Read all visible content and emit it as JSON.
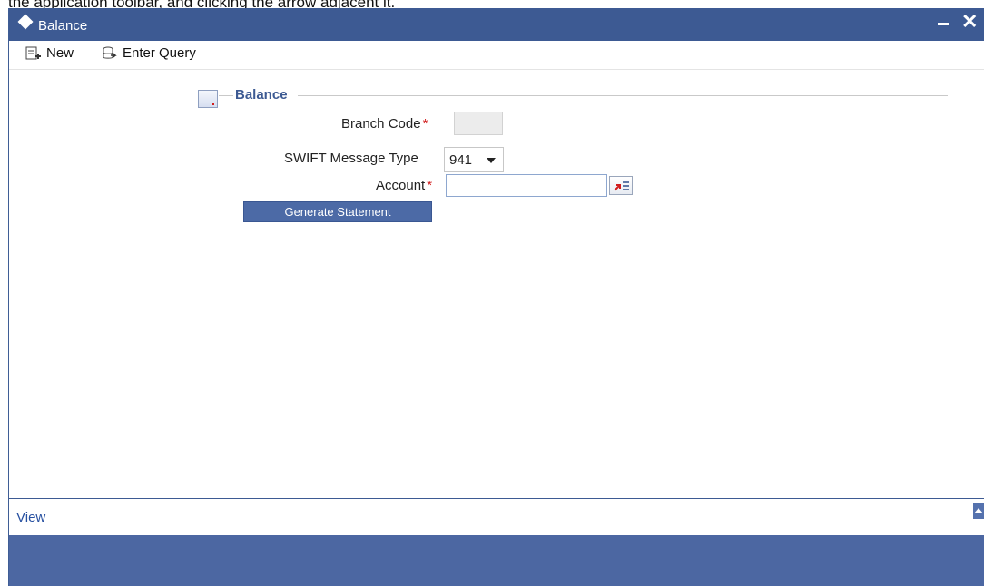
{
  "document_fragment": "the application toolbar, and clicking the arrow adjacent it.",
  "window": {
    "title": "Balance",
    "minimize_label": "",
    "close_label": "✕"
  },
  "toolbar": {
    "new_label": "New",
    "enter_query_label": "Enter Query"
  },
  "section": {
    "title": "Balance"
  },
  "form": {
    "branch_code_label": "Branch Code",
    "branch_code_value": "",
    "swift_message_type_label": "SWIFT Message Type",
    "swift_message_type_value": "941",
    "account_label": "Account",
    "account_value": "",
    "required_marker": "*",
    "generate_statement_label": "Generate Statement"
  },
  "footer": {
    "view_label": "View"
  },
  "colors": {
    "title_bar": "#3d5a93",
    "button": "#4c6aa6",
    "required": "#d21e1e",
    "footer_bar": "#4c67a2"
  },
  "icons": {
    "window": "diamond-icon",
    "new": "new-document-icon",
    "enter_query": "enter-query-icon",
    "section": "section-collapse-icon",
    "lov": "list-of-values-icon",
    "scroll": "scroll-up-icon"
  }
}
